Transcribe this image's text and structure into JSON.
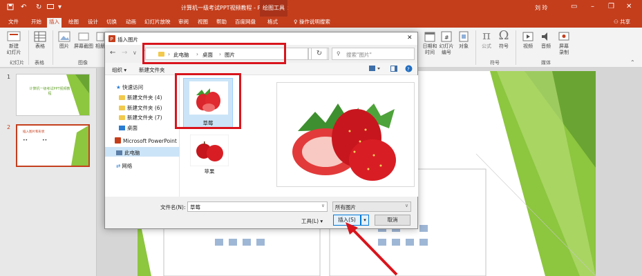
{
  "window": {
    "title": "计算机一级考试PPT视频教程 - PowerPoint",
    "context_tab": "绘图工具",
    "user": "刘 玲"
  },
  "tabs": [
    "文件",
    "开始",
    "插入",
    "绘图",
    "设计",
    "切换",
    "动画",
    "幻灯片放映",
    "审阅",
    "视图",
    "帮助",
    "百度网盘",
    "格式"
  ],
  "tell_me": "操作说明搜索",
  "share": "共享",
  "ribbon": {
    "new_slide": "新建\n幻灯片",
    "table": "表格",
    "image": "图片",
    "screenshot": "屏幕截图",
    "album": "相册",
    "datetime": "日期和时间",
    "slide_number": "幻灯片\n编号",
    "object": "对象",
    "formula": "公式",
    "symbol": "符号",
    "video": "视频",
    "audio": "音频",
    "record": "屏幕\n录制",
    "group_slides": "幻灯片",
    "group_tables": "表格",
    "group_images": "图像",
    "group_symbols": "符号",
    "group_media": "媒体"
  },
  "thumbnails": [
    {
      "num": "1",
      "title": "计算机一级考试PPT视频教程"
    },
    {
      "num": "2",
      "title": "插入图片和形状"
    }
  ],
  "dialog": {
    "title": "插入图片",
    "path": [
      "此电脑",
      "桌面",
      "图片"
    ],
    "search_placeholder": "搜索\"图片\"",
    "organize": "组织",
    "new_folder": "新建文件夹",
    "nav": {
      "quick_access": "快速访问",
      "folders": [
        "新建文件夹 (4)",
        "新建文件夹 (6)",
        "新建文件夹 (7)"
      ],
      "desktop": "桌面",
      "microsoft_ppt": "Microsoft PowerPoint",
      "this_pc": "此电脑",
      "network": "网络"
    },
    "files": [
      {
        "name": "草莓",
        "selected": true
      },
      {
        "name": "苹果",
        "selected": false
      }
    ],
    "filename_label": "文件名(N):",
    "filename_value": "草莓",
    "filetype": "所有图片",
    "tools": "工具(L)",
    "insert": "插入(S)",
    "cancel": "取消"
  },
  "colors": {
    "accent": "#c43e1c",
    "highlight": "#d9141c",
    "green": "#8dc63f"
  }
}
